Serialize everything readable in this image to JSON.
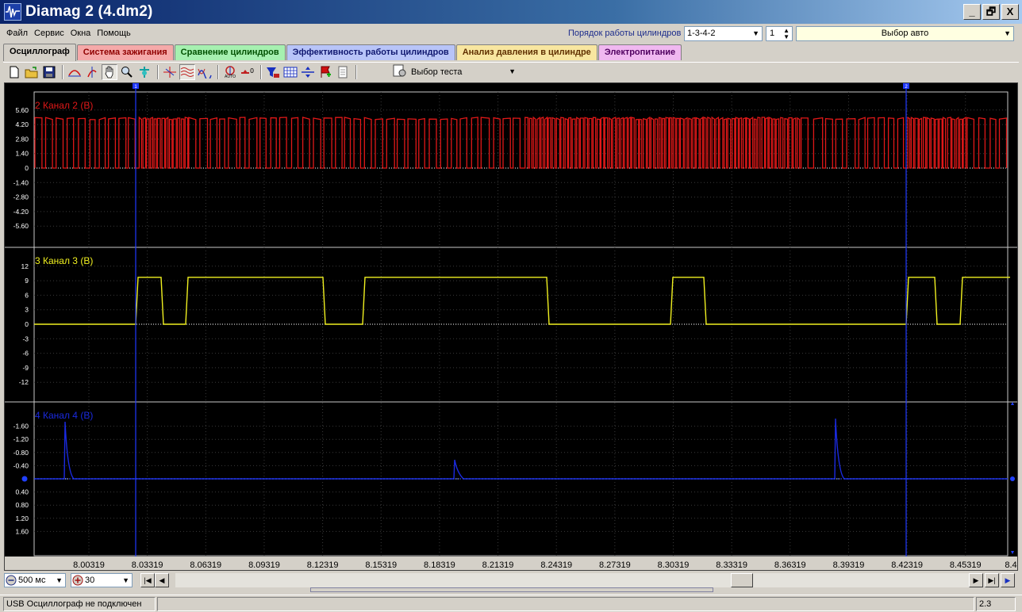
{
  "window": {
    "title": "Diamag 2 (4.dm2)",
    "buttons": {
      "minimize": "_",
      "restore": "🗗",
      "close": "X"
    }
  },
  "menu": [
    "Файл",
    "Сервис",
    "Окна",
    "Помощь"
  ],
  "cylinders": {
    "order_label": "Порядок работы цилиндров",
    "order_value": "1-3-4-2",
    "spin_value": "1",
    "auto_select": "Выбор авто"
  },
  "tabs": [
    {
      "label": "Осциллограф",
      "active": true,
      "color": "#d4d0c8"
    },
    {
      "label": "Система зажигания",
      "active": false,
      "color": "#f5a9a9"
    },
    {
      "label": "Сравнение цилиндров",
      "active": false,
      "color": "#a6f0b0"
    },
    {
      "label": "Эффективность работы цилиндров",
      "active": false,
      "color": "#b8c4f8"
    },
    {
      "label": "Анализ давления в цилиндре",
      "active": false,
      "color": "#f8e6a0"
    },
    {
      "label": "Электропитание",
      "active": false,
      "color": "#f0b8f0"
    }
  ],
  "toolbar": {
    "test_select": "Выбор теста",
    "icons": [
      "new-icon",
      "open-icon",
      "save-icon",
      "fit-horizontal-icon",
      "fit-vertical-icon",
      "hand-icon",
      "zoom-icon",
      "scale-icon",
      "cursor-icon",
      "stack-icon",
      "overlay-icon",
      "auto-icon",
      "zero-icon",
      "filter-icon",
      "grid-icon",
      "split-icon",
      "marker-icon",
      "note-icon"
    ]
  },
  "chart_data": {
    "type": "line",
    "x_ticks": [
      "8.00319",
      "8.03319",
      "8.06319",
      "8.09319",
      "8.12319",
      "8.15319",
      "8.18319",
      "8.21319",
      "8.24319",
      "8.27319",
      "8.30319",
      "8.33319",
      "8.36319",
      "8.39319",
      "8.42319",
      "8.45319",
      "8.4"
    ],
    "cursors": [
      "1",
      "2"
    ],
    "channels": [
      {
        "name": "2 Канал 2 (В)",
        "color": "#e01818",
        "y_ticks": [
          "5.60",
          "4.20",
          "2.80",
          "1.40",
          "0",
          "-1.40",
          "-2.80",
          "-4.20",
          "-5.60"
        ],
        "high": 4.9,
        "low": 0
      },
      {
        "name": "3 Канал 3 (В)",
        "color": "#f0f020",
        "y_ticks": [
          "12",
          "9",
          "6",
          "3",
          "0",
          "-3",
          "-6",
          "-9",
          "-12"
        ],
        "high": 9.7,
        "low": 0
      },
      {
        "name": "4 Канал 4 (В)",
        "color": "#1a2ae0",
        "y_ticks": [
          "-1.60",
          "-1.20",
          "-0.80",
          "-0.40",
          "",
          "0.40",
          "0.80",
          "1.20",
          "1.60"
        ]
      }
    ]
  },
  "bottom": {
    "timebase": "500 мс",
    "zoom": "30"
  },
  "status": {
    "connection": "USB Осциллограф не подключен",
    "version": "2.3"
  }
}
